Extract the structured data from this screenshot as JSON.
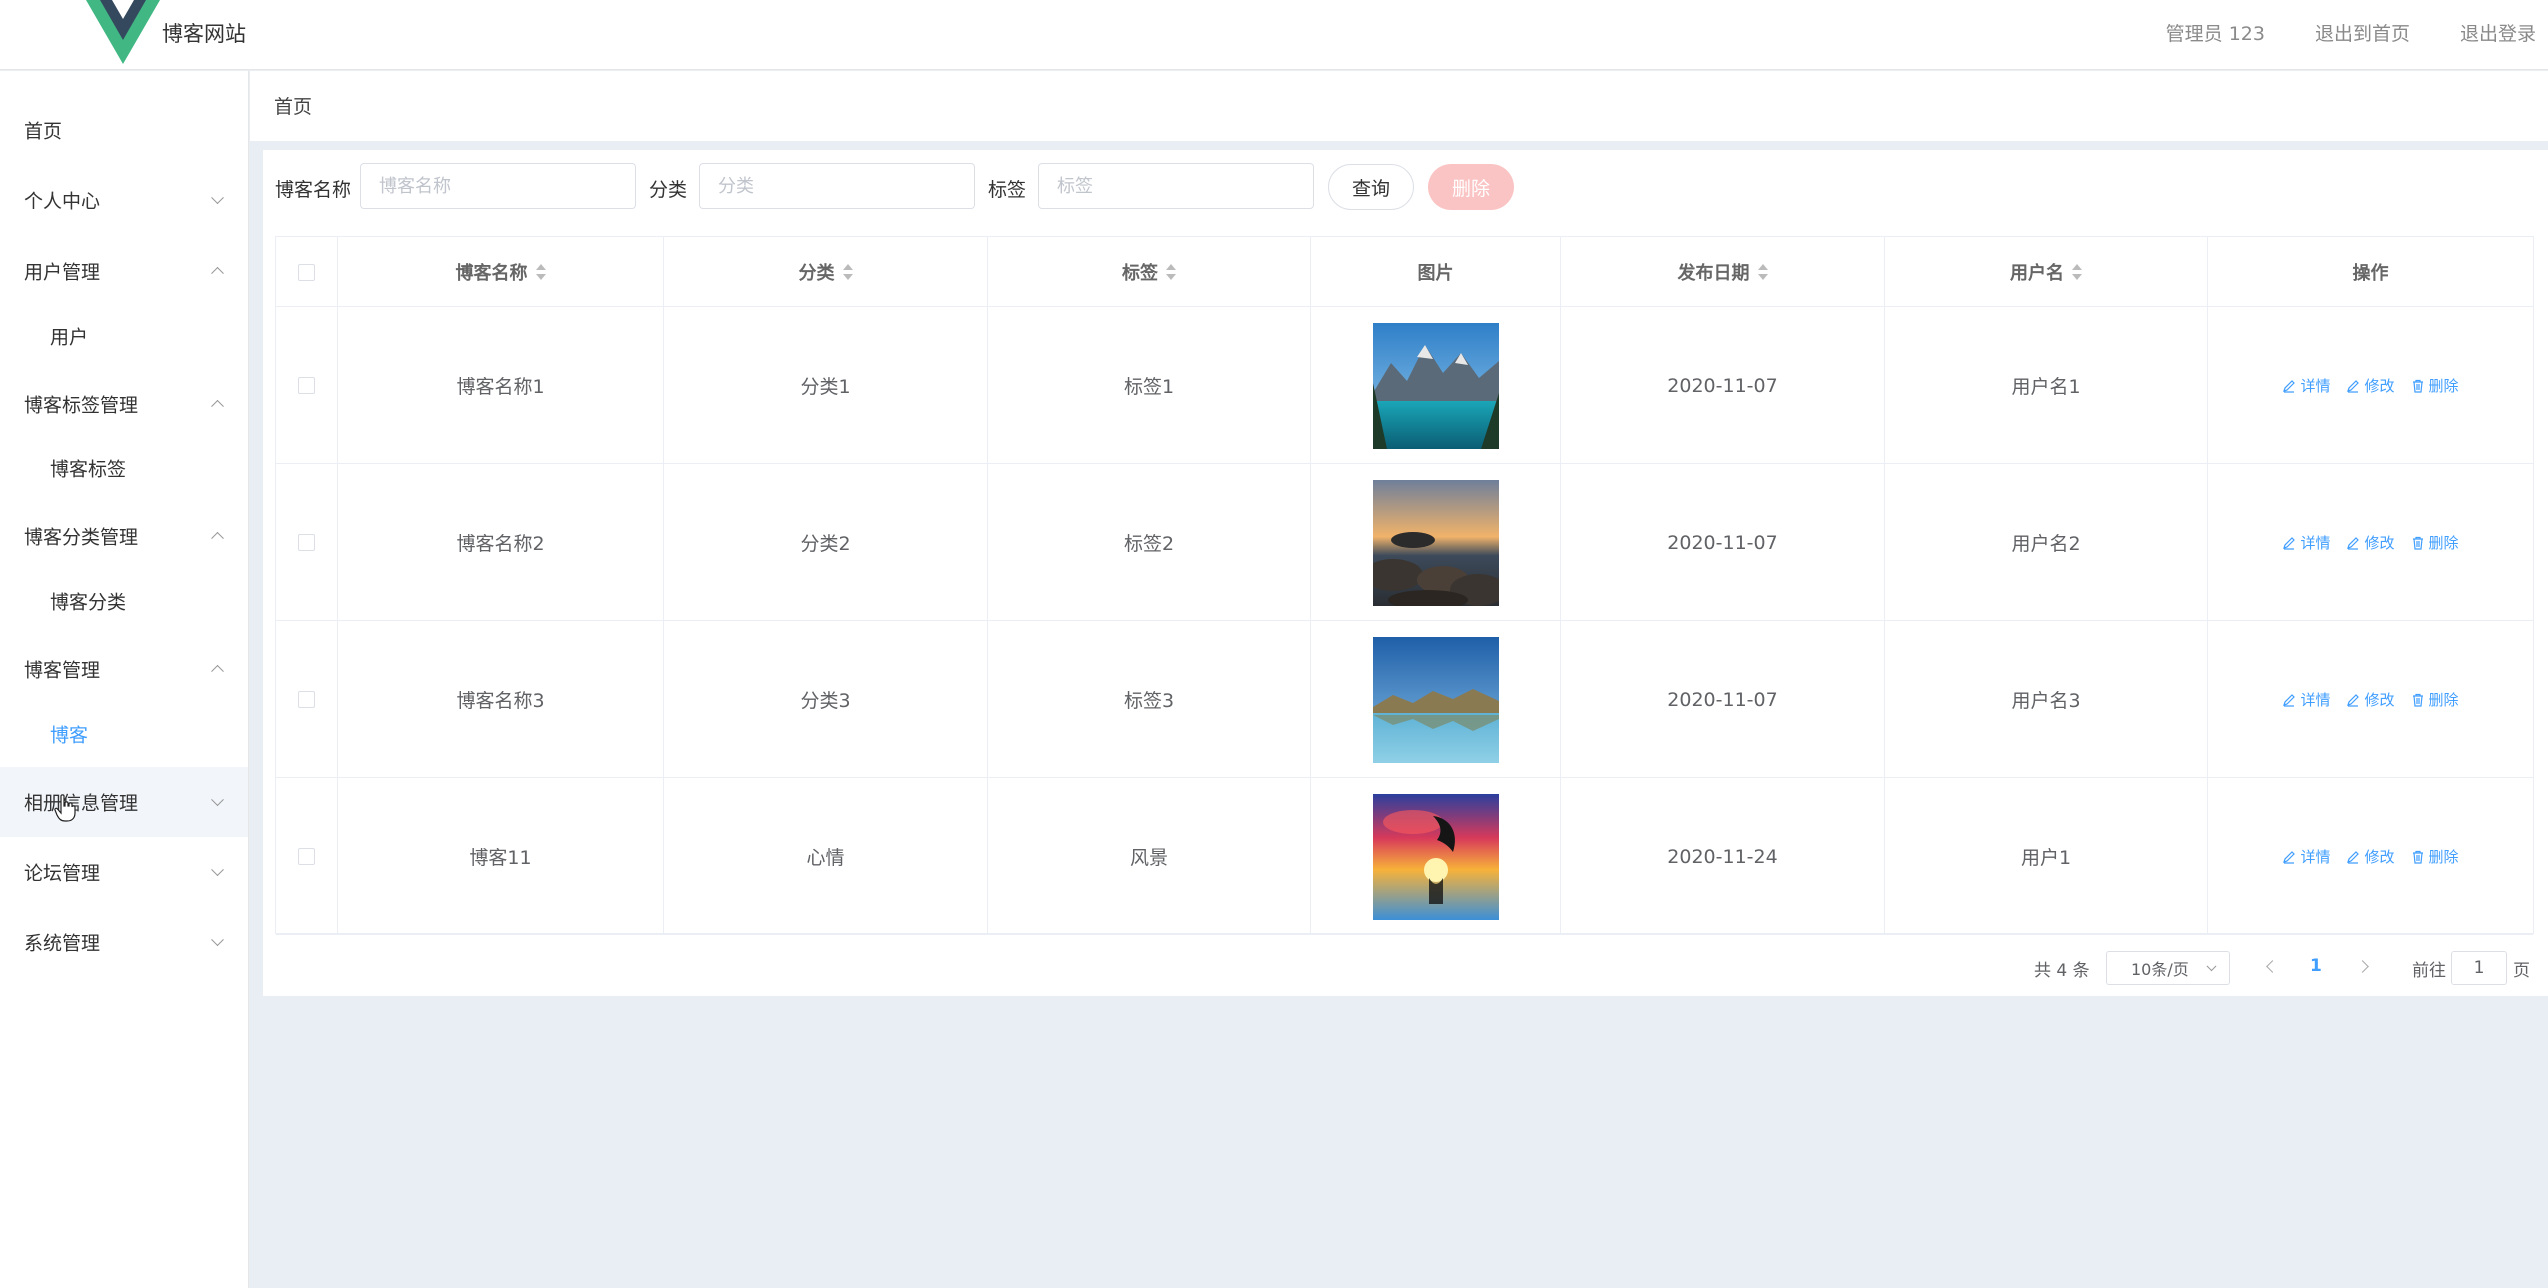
{
  "header": {
    "title": "博客网站",
    "admin_label": "管理员 123",
    "exit_home_label": "退出到首页",
    "logout_label": "退出登录",
    "logo_colors": {
      "outer": "#41b883",
      "inner": "#35495e"
    }
  },
  "sidebar": {
    "items": [
      {
        "label": "首页",
        "expandable": false
      },
      {
        "label": "个人中心",
        "expandable": true,
        "expanded": false
      },
      {
        "label": "用户管理",
        "expandable": true,
        "expanded": true
      },
      {
        "label": "用户",
        "sub": true
      },
      {
        "label": "博客标签管理",
        "expandable": true,
        "expanded": true
      },
      {
        "label": "博客标签",
        "sub": true
      },
      {
        "label": "博客分类管理",
        "expandable": true,
        "expanded": true
      },
      {
        "label": "博客分类",
        "sub": true
      },
      {
        "label": "博客管理",
        "expandable": true,
        "expanded": true
      },
      {
        "label": "博客",
        "sub": true,
        "active": true
      },
      {
        "label": "相册信息管理",
        "expandable": true,
        "expanded": false
      },
      {
        "label": "论坛管理",
        "expandable": true,
        "expanded": false
      },
      {
        "label": "系统管理",
        "expandable": true,
        "expanded": false
      }
    ]
  },
  "breadcrumb": {
    "home": "首页"
  },
  "filters": {
    "blog_name": {
      "label": "博客名称",
      "placeholder": "博客名称",
      "value": ""
    },
    "category": {
      "label": "分类",
      "placeholder": "分类",
      "value": ""
    },
    "tag": {
      "label": "标签",
      "placeholder": "标签",
      "value": ""
    },
    "query_button": "查询",
    "delete_button": "删除"
  },
  "table": {
    "columns": [
      "博客名称",
      "分类",
      "标签",
      "图片",
      "发布日期",
      "用户名",
      "操作"
    ],
    "rows": [
      {
        "name": "博客名称1",
        "category": "分类1",
        "tag": "标签1",
        "image": "mountain-lake",
        "date": "2020-11-07",
        "user": "用户名1"
      },
      {
        "name": "博客名称2",
        "category": "分类2",
        "tag": "标签2",
        "image": "rocky-shore-sunset",
        "date": "2020-11-07",
        "user": "用户名2"
      },
      {
        "name": "博客名称3",
        "category": "分类3",
        "tag": "标签3",
        "image": "calm-lake-reflection",
        "date": "2020-11-07",
        "user": "用户名3"
      },
      {
        "name": "博客11",
        "category": "心情",
        "tag": "风景",
        "image": "dolphin-sunset",
        "date": "2020-11-24",
        "user": "用户1"
      }
    ],
    "actions": {
      "detail": "详情",
      "edit": "修改",
      "delete": "删除"
    }
  },
  "pagination": {
    "total_label": "共 4 条",
    "page_size": "10条/页",
    "current_page": "1",
    "goto_label": "前往",
    "goto_value": "1",
    "page_suffix": "页"
  },
  "colors": {
    "primary": "#409eff",
    "danger_light": "#fbc4c4",
    "background": "#e9eef5"
  }
}
